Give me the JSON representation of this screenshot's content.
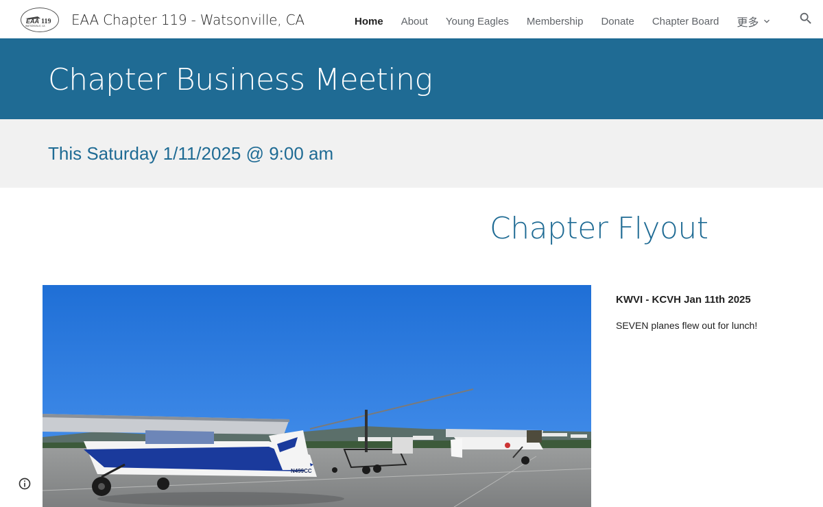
{
  "header": {
    "site_title": "EAA Chapter 119 - Watsonville, CA",
    "logo": {
      "icon": "eaa-chapter-119-logo",
      "text_top": "EAA",
      "text_number": "119",
      "text_bottom": "WATSONVILLE, CA"
    },
    "nav": {
      "items": [
        {
          "label": "Home",
          "active": true
        },
        {
          "label": "About",
          "active": false
        },
        {
          "label": "Young Eagles",
          "active": false
        },
        {
          "label": "Membership",
          "active": false
        },
        {
          "label": "Donate",
          "active": false
        },
        {
          "label": "Chapter Board",
          "active": false
        }
      ],
      "more_label": "更多",
      "more_icon": "chevron-down-icon",
      "search_icon": "search-icon"
    }
  },
  "title_band": {
    "title": "Chapter Business Meeting",
    "background": "#1f6b94"
  },
  "meeting": {
    "text": "This Saturday 1/11/2025 @ 9:00 am",
    "background": "#f1f1f1",
    "color": "#1f6b94"
  },
  "flyout": {
    "heading": "Chapter Flyout",
    "route": "KWVI - KCVH Jan 11th 2025",
    "description": "SEVEN planes flew out for lunch!",
    "photo_subject": "airplanes-on-ramp-photo",
    "aircraft_registration": "N499CC"
  },
  "footer": {
    "info_icon": "info-icon"
  },
  "colors": {
    "accent": "#1f6b94",
    "text": "#212121",
    "nav_text": "#5f6368"
  }
}
